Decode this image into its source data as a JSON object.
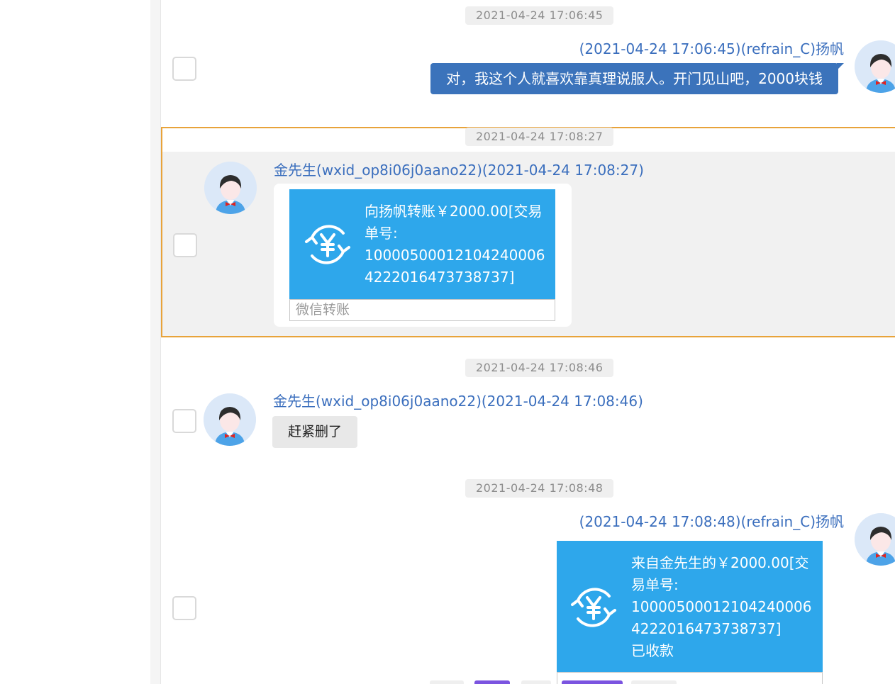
{
  "messages": [
    {
      "timestamp": "2021-04-24 17:06:45",
      "sender": "(2021-04-24 17:06:45)(refrain_C)扬帆",
      "text": "对，我这个人就喜欢靠真理说服人。开门见山吧，2000块钱"
    },
    {
      "timestamp": "2021-04-24 17:08:27",
      "sender": "金先生(wxid_op8i06j0aano22)(2021-04-24 17:08:27)",
      "transfer_lines": [
        "向扬帆转账￥2000.00[交易",
        "单号:",
        "10000500012104240006",
        "4222016473738737]"
      ],
      "transfer_footer": "微信转账"
    },
    {
      "timestamp": "2021-04-24 17:08:46",
      "sender": "金先生(wxid_op8i06j0aano22)(2021-04-24 17:08:46)",
      "text": "赶紧删了"
    },
    {
      "timestamp": "2021-04-24 17:08:48",
      "sender": "(2021-04-24 17:08:48)(refrain_C)扬帆",
      "transfer_lines": [
        "来自金先生的￥2000.00[交",
        "易单号:",
        "10000500012104240006",
        "4222016473738737]",
        "已收款"
      ]
    }
  ],
  "colors": {
    "sender_blue": "#3a6ebd",
    "transfer_blue": "#2ea7eb",
    "bubble_blue": "#3b73bb",
    "highlight_border": "#e8a33a"
  },
  "icons": [
    "avatar-icon",
    "yen-transfer-icon",
    "checkbox"
  ]
}
